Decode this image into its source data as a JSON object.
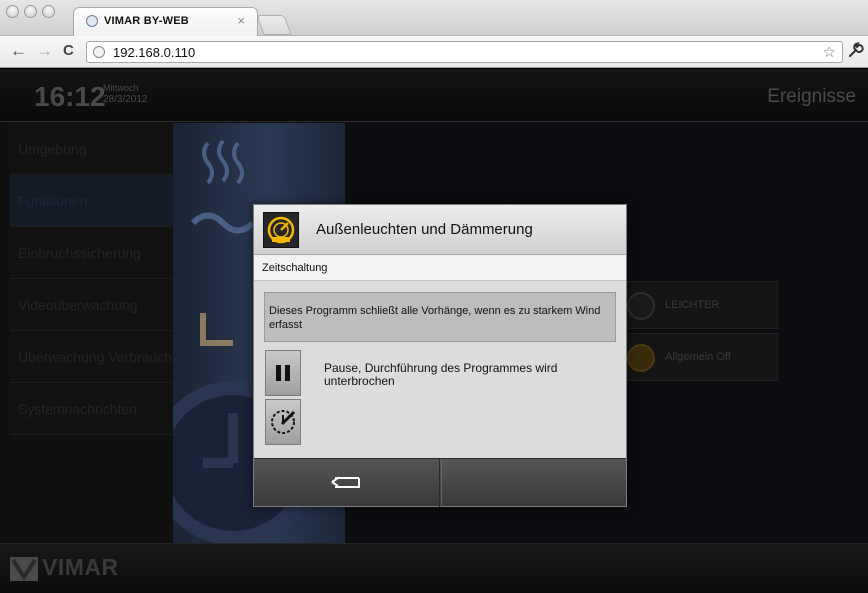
{
  "browser": {
    "tab_title": "VIMAR BY-WEB",
    "tab_close": "×",
    "url": "192.168.0.110",
    "star": "☆",
    "wrench": "🔧",
    "back": "←",
    "forward": "→",
    "reload": "C"
  },
  "header": {
    "time": "16:12",
    "weekday": "Mittwoch",
    "date": "28/3/2012",
    "events_label": "Ereignisse"
  },
  "sidebar": {
    "items": [
      {
        "label": "Umgebung"
      },
      {
        "label": "Funktionen"
      },
      {
        "label": "Einbruchssicherung"
      },
      {
        "label": "Videoüberwachung"
      },
      {
        "label": "Überwachung Verbrauch"
      },
      {
        "label": "Systemnachrichten"
      }
    ]
  },
  "background_tiles": [
    {
      "label": "LEICHTER",
      "icon": "gauge-icon"
    },
    {
      "label": "Allgemein Off",
      "icon": "gauge-icon"
    }
  ],
  "dialog": {
    "title": "Außenleuchten und Dämmerung",
    "subtitle": "Zeitschaltung",
    "description": "Dieses Programm schließt alle Vorhänge, wenn es zu starkem Wind erfasst",
    "action_text": "Pause, Durchführung des Programmes wird unterbrochen",
    "icon": "gauge-icon",
    "accent_color": "#f5b800"
  },
  "footer": {
    "brand": "VIMAR"
  }
}
